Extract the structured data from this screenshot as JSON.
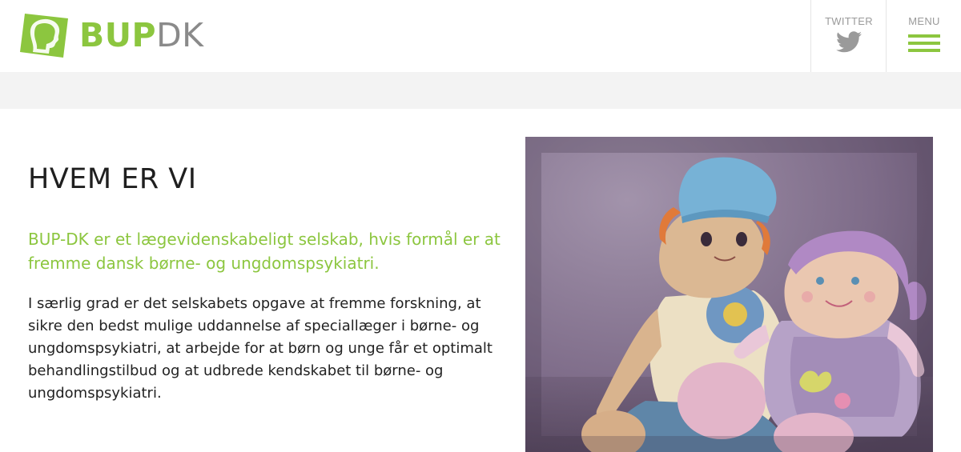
{
  "header": {
    "logo": {
      "bold": "BUP",
      "light": "DK"
    },
    "twitter_label": "TWITTER",
    "menu_label": "MENU"
  },
  "content": {
    "heading": "HVEM ER VI",
    "lead": "BUP-DK er et lægevidenskabeligt selskab, hvis formål er at fremme dansk børne- og ungdomspsykiatri.",
    "body": "I særlig grad er det selskabets opgave at fremme forskning, at sikre den bedst mulige uddannelse af speciallæger i børne- og ungdomspsykiatri, at arbejde for at børn og unge får et optimalt behandlingstilbud og at udbrede kendskabet til børne- og ungdomspsykiatri."
  },
  "colors": {
    "brand_green": "#8cc63f",
    "logo_grey": "#8a8a8a",
    "band_grey": "#f3f3f3"
  },
  "icons": [
    "logo-mark-icon",
    "twitter-bird-icon",
    "hamburger-menu-icon"
  ]
}
